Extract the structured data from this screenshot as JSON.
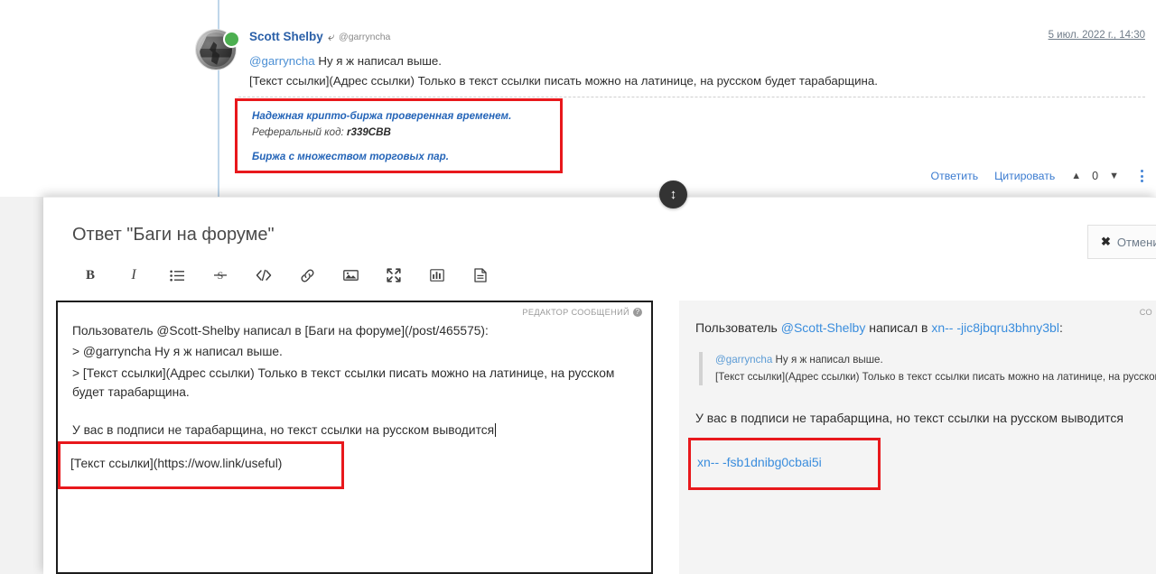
{
  "post": {
    "author": "Scott Shelby",
    "reply_icon": "reply-arrow-icon",
    "parent_handle": "@garryncha",
    "date": "5 июл. 2022 г., 14:30",
    "body_line_1_mention": "@garryncha",
    "body_line_1_rest": " Ну я ж написал выше.",
    "body_line_2": "[Текст ссылки](Адрес ссылки) Только в текст ссылки писать можно на латинице, на русском будет тарабарщина.",
    "signature": {
      "line1": "Надежная крипто-биржа проверенная временем.",
      "line2_label": "Реферальный код: ",
      "line2_code": "r339CBB",
      "line3": "Биржа с множеством торговых пар."
    },
    "actions": {
      "reply": "Ответить",
      "quote": "Цитировать",
      "upvote_icon": "chevron-up-icon",
      "vote_count": "0",
      "downvote_icon": "chevron-down-icon",
      "more_icon": "kebab-menu-icon"
    }
  },
  "editor": {
    "title": "Ответ \"Баги на форуме\"",
    "cancel_label": "Отменить",
    "cancel_icon": "close-x-icon",
    "resize_icon": "resize-vertical-icon",
    "toolbar": [
      {
        "name": "bold-button",
        "label": "B"
      },
      {
        "name": "italic-button",
        "label": "I"
      },
      {
        "name": "bullet-list-button",
        "label": "list"
      },
      {
        "name": "strikethrough-button",
        "label": "S"
      },
      {
        "name": "code-button",
        "label": "</>"
      },
      {
        "name": "link-button",
        "label": "link"
      },
      {
        "name": "image-button",
        "label": "image"
      },
      {
        "name": "fullscreen-button",
        "label": "expand"
      },
      {
        "name": "poll-button",
        "label": "chart"
      },
      {
        "name": "document-button",
        "label": "doc"
      }
    ],
    "markdown_label": "РЕДАКТОР СООБЩЕНИЙ",
    "help_icon": "question-mark-icon",
    "markdown": {
      "line1": "Пользователь @Scott-Shelby написал в [Баги на форуме](/post/465575):",
      "line2": "> @garryncha Ну я ж написал выше.",
      "line3": "> [Текст ссылки](Адрес ссылки) Только в текст ссылки писать можно на латинице, на русском будет тарабарщина.",
      "line4": "У вас в подписи не тарабарщина, но текст ссылки на русском выводится",
      "annotated_link": "[Текст ссылки](https://wow.link/useful)"
    },
    "preview": {
      "badge": "СО",
      "line1_prefix": "Пользователь ",
      "line1_mention": "@Scott-Shelby",
      "line1_mid": " написал в ",
      "line1_link": "xn-- -jic8jbqru3bhny3bl",
      "line1_suffix": ":",
      "quote_mention": "@garryncha",
      "quote_line1_rest": " Ну я ж написал выше.",
      "quote_line2": "[Текст ссылки](Адрес ссылки) Только в текст ссылки писать можно на латинице, на русском будет",
      "line2": "У вас в подписи не тарабарщина, но текст ссылки на русском выводится",
      "annotated_link": "xn-- -fsb1dnibg0cbai5i"
    }
  },
  "colors": {
    "accent_blue": "#3a7bd0",
    "link_blue": "#3a8ddd",
    "annotation_red": "#e8181c",
    "online_green": "#4caf50",
    "signature_blue": "#2565b8"
  }
}
